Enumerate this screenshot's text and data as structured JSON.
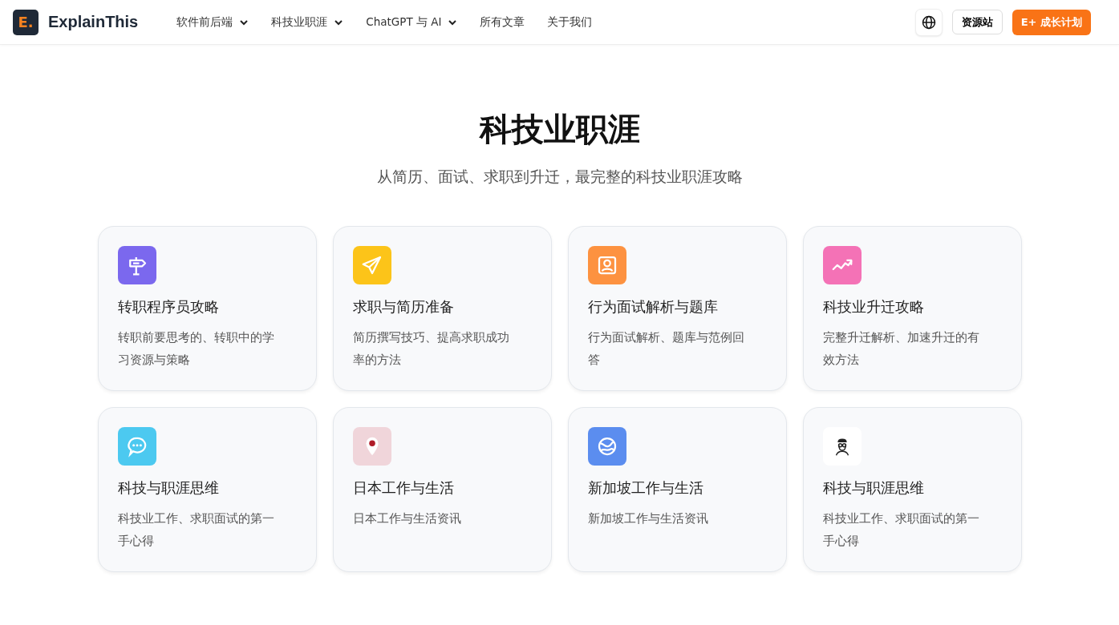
{
  "header": {
    "logo_mark": "E.",
    "brand": "ExplainThis",
    "nav": [
      {
        "label": "软件前后端",
        "kind": "dropdown"
      },
      {
        "label": "科技业职涯",
        "kind": "dropdown"
      },
      {
        "label": "ChatGPT 与 AI",
        "kind": "dropdown"
      },
      {
        "label": "所有文章",
        "kind": "link"
      },
      {
        "label": "关于我们",
        "kind": "link"
      }
    ],
    "resources_button": "资源站",
    "cta_button": "E+ 成长计划"
  },
  "hero": {
    "title": "科技业职涯",
    "subtitle": "从简历、面试、求职到升迁，最完整的科技业职涯攻略"
  },
  "cards": [
    {
      "kind": "signpost",
      "color": "#7b68ee",
      "title": "转职程序员攻略",
      "description": "转职前要思考的、转职中的学习资源与策略"
    },
    {
      "kind": "send",
      "color": "#fcc419",
      "title": "求职与简历准备",
      "description": "简历撰写技巧、提高求职成功率的方法"
    },
    {
      "kind": "portrait",
      "color": "#fd9240",
      "title": "行为面试解析与题库",
      "description": "行为面试解析、题库与范例回答"
    },
    {
      "kind": "trend",
      "color": "#f472b6",
      "title": "科技业升迁攻略",
      "description": "完整升迁解析、加速升迁的有效方法"
    },
    {
      "kind": "chat",
      "color": "#4cc9f0",
      "title": "科技与职涯思维",
      "description": "科技业工作、求职面试的第一手心得"
    },
    {
      "kind": "pin",
      "color": "#f0d5da",
      "title": "日本工作与生活",
      "description": "日本工作与生活资讯"
    },
    {
      "kind": "globe",
      "color": "#5b8def",
      "title": "新加坡工作与生活",
      "description": "新加坡工作与生活资讯"
    },
    {
      "kind": "person",
      "color": "#ffffff",
      "title": "科技与职涯思维",
      "description": "科技业工作、求职面试的第一手心得"
    }
  ]
}
